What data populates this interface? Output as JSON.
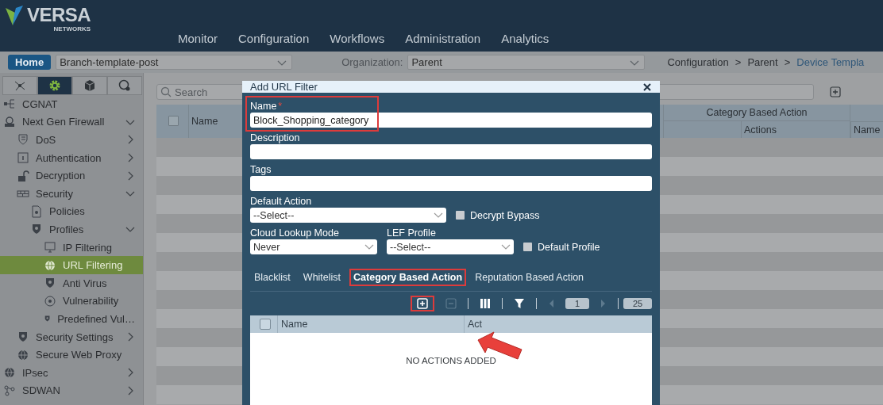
{
  "header": {
    "logo": {
      "name": "VERSA",
      "tagline": "NETWORKS"
    },
    "nav": [
      {
        "label": "Monitor"
      },
      {
        "label": "Configuration"
      },
      {
        "label": "Workflows"
      },
      {
        "label": "Administration"
      },
      {
        "label": "Analytics"
      }
    ]
  },
  "toolbar": {
    "home": "Home",
    "template": "Branch-template-post",
    "organization_label": "Organization:",
    "organization": "Parent",
    "breadcrumb": [
      {
        "kind": "text",
        "label": "Configuration"
      },
      {
        "kind": "separator",
        "label": ">"
      },
      {
        "kind": "text",
        "label": "Parent"
      },
      {
        "kind": "separator",
        "label": ">"
      },
      {
        "kind": "link",
        "label": "Device Templa"
      }
    ]
  },
  "sidebar": {
    "tabs": [
      {
        "kind": "topology",
        "selected": false
      },
      {
        "kind": "gear",
        "selected": true
      },
      {
        "kind": "cube",
        "selected": false
      },
      {
        "kind": "globe",
        "selected": false
      }
    ],
    "items": [
      {
        "label": "CGNAT",
        "kind": "nat",
        "selected": false
      },
      {
        "label": "Next Gen Firewall",
        "kind": "firewall",
        "selected": false,
        "expanded": true,
        "children": [
          {
            "label": "DoS",
            "kind": "dos",
            "selected": false,
            "expanded": false
          },
          {
            "label": "Authentication",
            "kind": "auth",
            "selected": false,
            "expanded": false
          },
          {
            "label": "Decryption",
            "kind": "lock",
            "selected": false,
            "expanded": false
          },
          {
            "label": "Security",
            "kind": "wall",
            "selected": false,
            "expanded": true,
            "children": [
              {
                "label": "Policies",
                "kind": "policy",
                "selected": false
              },
              {
                "label": "Profiles",
                "kind": "shield",
                "selected": false,
                "expanded": true,
                "children": [
                  {
                    "label": "IP Filtering",
                    "kind": "monitor",
                    "selected": false
                  },
                  {
                    "label": "URL Filtering",
                    "kind": "globe",
                    "selected": true
                  },
                  {
                    "label": "Anti Virus",
                    "kind": "shield",
                    "selected": false
                  },
                  {
                    "label": "Vulnerability",
                    "kind": "target",
                    "selected": false
                  },
                  {
                    "label": "Predefined Vul…",
                    "kind": "shield",
                    "selected": false
                  }
                ]
              }
            ]
          },
          {
            "label": "Security Settings",
            "kind": "shield",
            "selected": false,
            "expanded": false
          },
          {
            "label": "Secure Web Proxy",
            "kind": "globe",
            "selected": false
          }
        ]
      },
      {
        "label": "IPsec",
        "kind": "globe",
        "selected": false,
        "expanded": false
      },
      {
        "label": "SDWAN",
        "kind": "sdwan",
        "selected": false,
        "expanded": false
      }
    ]
  },
  "main": {
    "search": {
      "placeholder": "Search"
    },
    "table": {
      "select_all_checked": false,
      "columns": [
        {
          "label": "Name"
        }
      ],
      "group": {
        "label": "Category Based Action",
        "columns": [
          {
            "label": "Actions"
          }
        ]
      },
      "trailing_column": {
        "label": "Name"
      }
    }
  },
  "dialog": {
    "title": "Add URL Filter",
    "rows": [
      [
        {
          "kind": "text",
          "label": "Name",
          "required_mark": "*",
          "value": "Block_Shopping_category",
          "highlighted": true
        }
      ],
      [
        {
          "kind": "text",
          "label": "Description",
          "highlighted": false
        }
      ],
      [
        {
          "kind": "text",
          "label": "Tags",
          "highlighted": false
        }
      ],
      [
        {
          "kind": "select",
          "label": "Default Action",
          "value": "--Select--"
        },
        {
          "kind": "checkbox",
          "label": "Decrypt Bypass",
          "checked": false
        }
      ],
      [
        {
          "kind": "select",
          "label": "Cloud Lookup Mode",
          "value": "Never"
        },
        {
          "kind": "select",
          "label": "LEF Profile",
          "value": "--Select--"
        },
        {
          "kind": "checkbox",
          "label": "Default Profile",
          "checked": false
        }
      ]
    ],
    "tabs": [
      {
        "label": "Blacklist",
        "selected": false,
        "highlighted": false
      },
      {
        "label": "Whitelist",
        "selected": false,
        "highlighted": false
      },
      {
        "label": "Category Based Action",
        "selected": true,
        "highlighted": true
      },
      {
        "label": "Reputation Based Action",
        "selected": false,
        "highlighted": false
      }
    ],
    "grid_toolbar": [
      {
        "kind": "add",
        "disabled": false,
        "highlighted": true
      },
      {
        "kind": "remove",
        "disabled": true,
        "highlighted": false
      },
      {
        "kind": "columns",
        "disabled": false,
        "highlighted": false
      },
      {
        "kind": "filter",
        "disabled": false,
        "highlighted": false
      },
      {
        "kind": "prev",
        "disabled": true,
        "highlighted": false
      },
      {
        "kind": "page",
        "value": "1"
      },
      {
        "kind": "next",
        "disabled": true,
        "highlighted": false
      },
      {
        "kind": "page_size",
        "value": "25"
      }
    ],
    "grid": {
      "select_all_checked": false,
      "columns": [
        {
          "label": "Name"
        },
        {
          "label": "Act"
        }
      ],
      "empty_message": "NO ACTIONS ADDED"
    }
  }
}
